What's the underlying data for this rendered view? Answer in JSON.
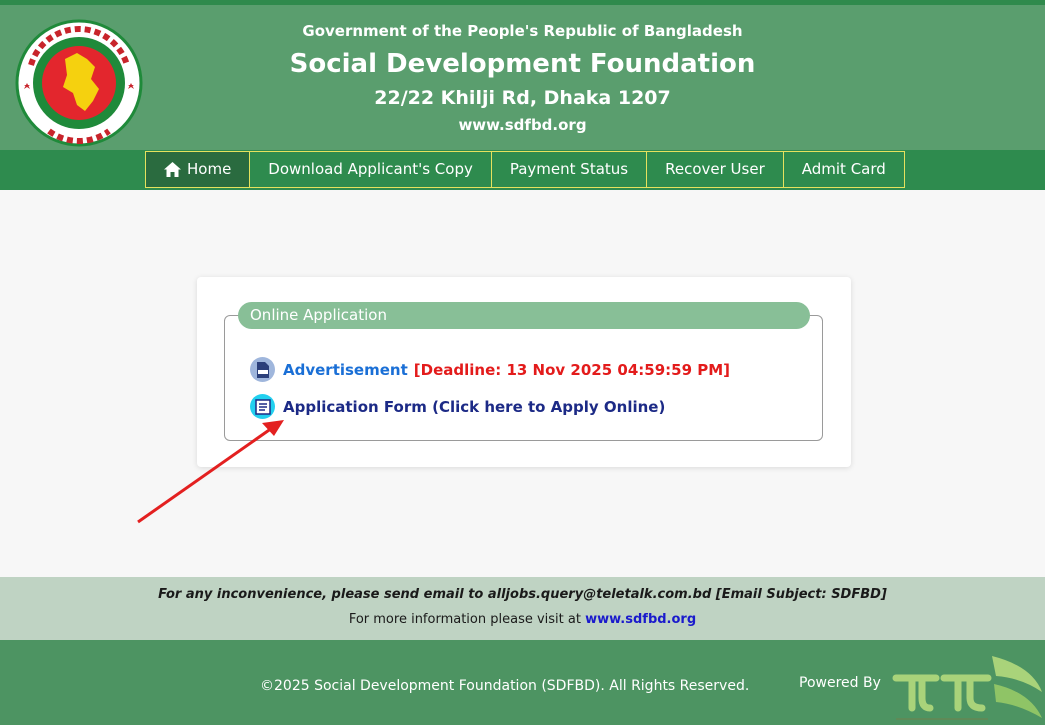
{
  "header": {
    "gov_line": "Government of the People's Republic of Bangladesh",
    "org_name": "Social Development Foundation",
    "address": "22/22 Khilji Rd, Dhaka 1207",
    "website": "www.sdfbd.org"
  },
  "nav": {
    "items": [
      {
        "label": "Home",
        "icon": "home-icon"
      },
      {
        "label": "Download Applicant's Copy"
      },
      {
        "label": "Payment Status"
      },
      {
        "label": "Recover User"
      },
      {
        "label": "Admit Card"
      }
    ]
  },
  "application": {
    "legend": "Online Application",
    "advertisement_label": "Advertisement",
    "deadline": "[Deadline: 13 Nov 2025 04:59:59 PM]",
    "form_label": "Application Form (Click here to Apply Online)",
    "advertisement_icon": "pdf-icon",
    "form_icon": "form-icon"
  },
  "info": {
    "contact_line": "For any inconvenience, please send email to alljobs.query@teletalk.com.bd [Email Subject: SDFBD]",
    "more_info_prefix": "For more information please visit at",
    "more_info_link": "www.sdfbd.org"
  },
  "footer": {
    "copyright": "©2025 Social Development Foundation (SDFBD). All Rights Reserved.",
    "powered_by": "Powered By"
  },
  "colors": {
    "header_bg": "#5a9e6e",
    "nav_bg": "#2e8b4e",
    "nav_border": "#e5e25e",
    "legend_bg": "#88bf97",
    "deadline": "#e31b1b",
    "footer_bg": "#4d9462",
    "info_bg": "#bfd3c3",
    "arrow": "#e32020"
  }
}
